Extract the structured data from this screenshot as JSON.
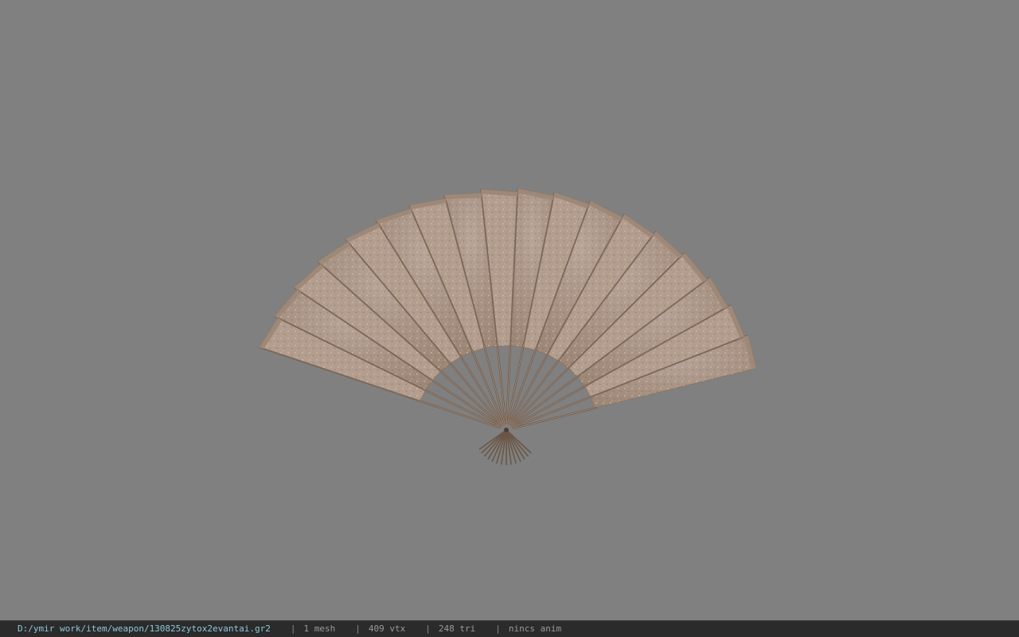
{
  "viewer": {
    "background_color": "#808080",
    "model_name": "fan-model"
  },
  "statusbar": {
    "file_path": "D:/ymir work/item/weapon/130825zytox2evantai.gr2",
    "separator": "|",
    "mesh_count": "1 mesh",
    "vertex_count": "409 vtx",
    "triangle_count": "248 tri",
    "animation": "nincs anim"
  },
  "colors": {
    "statusbar_bg": "#2b2b2b",
    "path_text": "#8fc8d8",
    "info_text": "#9a9a9a",
    "fan_paper": "#b39d8e",
    "fan_rib": "#6b5646"
  }
}
